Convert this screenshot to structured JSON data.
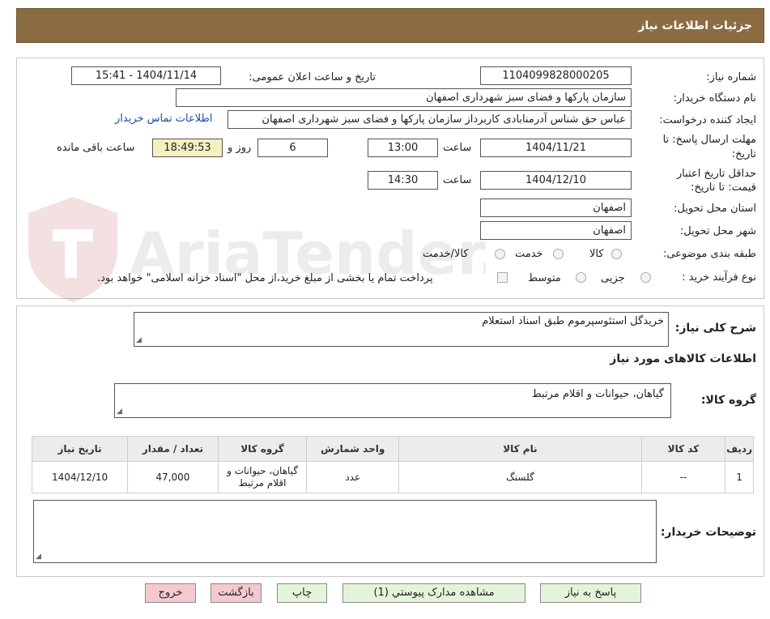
{
  "header": {
    "title": "جزئیات اطلاعات نیاز"
  },
  "watermark": {
    "text": "AriaTender.neT"
  },
  "fields": {
    "need_number_label": "شماره نیاز:",
    "need_number": "1104099828000205",
    "announce_label": "تاریخ و ساعت اعلان عمومی:",
    "announce_value": "1404/11/14 - 15:41",
    "buyer_org_label": "نام دستگاه خریدار:",
    "buyer_org": "سازمان پارکها و فضای سبز شهرداری اصفهان",
    "creator_label": "ایجاد کننده درخواست:",
    "creator": "عباس حق شناس آدرمنابادی کاربرداز سازمان پارکها و فضای سبز شهرداری اصفهان",
    "contact_link": "اطلاعات تماس خریدار",
    "deadline_label_1": "مهلت ارسال پاسخ: تا",
    "deadline_label_2": "تاریخ:",
    "deadline_date": "1404/11/21",
    "time_label": "ساعت",
    "deadline_time": "13:00",
    "days_value": "6",
    "days_label": "روز و",
    "remaining_time": "18:49:53",
    "remaining_label": "ساعت باقی مانده",
    "validity_label_1": "حداقل تاریخ اعتبار",
    "validity_label_2": "قیمت: تا تاریخ:",
    "validity_date": "1404/12/10",
    "validity_time": "14:30",
    "province_label": "استان محل تحویل:",
    "province": "اصفهان",
    "city_label": "شهر محل تحویل:",
    "city": "اصفهان",
    "category_label": "طبقه بندی موضوعی:",
    "category_options": [
      "کالا",
      "خدمت",
      "کالا/خدمت"
    ],
    "process_label": "نوع فرآیند خرید :",
    "process_options": [
      "جزیی",
      "متوسط"
    ],
    "payment_note": "پرداخت تمام یا بخشی از مبلغ خرید،از محل \"اسناد خزانه اسلامی\" خواهد بود."
  },
  "summary": {
    "label": "شرح کلی نیاز:",
    "value": "خریدگل استئوسپرموم طبق اسناد استعلام",
    "goods_info_title": "اطلاعات کالاهای مورد نیاز",
    "group_label": "گروه کالا:",
    "group_value": "گیاهان، حیوانات و اقلام مرتبط"
  },
  "table": {
    "headers": [
      "ردیف",
      "کد کالا",
      "نام کالا",
      "واحد شمارش",
      "گروه کالا",
      "تعداد / مقدار",
      "تاریخ نیاز"
    ],
    "rows": [
      [
        "1",
        "--",
        "گلسنگ",
        "عدد",
        "گیاهان، حیوانات و اقلام مرتبط",
        "47,000",
        "1404/12/10"
      ]
    ]
  },
  "notes": {
    "label": "توضیحات خریدار:",
    "value": ""
  },
  "buttons": {
    "reply": "پاسخ به نیاز",
    "attachments": "مشاهده مدارک پیوستي (1)",
    "print": "چاپ",
    "back": "بازگشت",
    "exit": "خروج"
  }
}
